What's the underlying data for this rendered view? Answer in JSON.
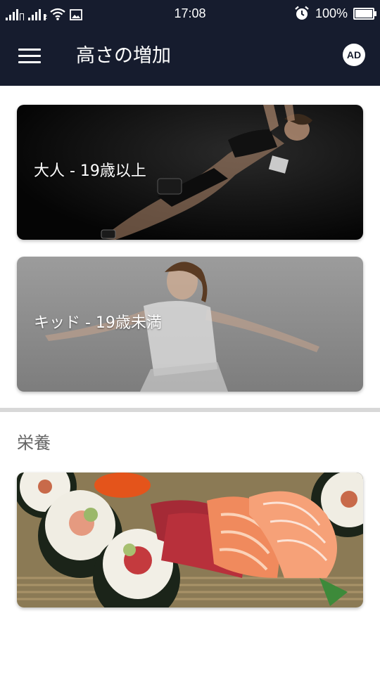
{
  "status_bar": {
    "sim1": "",
    "sim2": "2",
    "time": "17:08",
    "battery": "100%",
    "battery_level": 1.0,
    "icons": [
      "signal-icon",
      "signal-icon",
      "wifi-icon",
      "image-icon",
      "alarm-icon",
      "battery-icon"
    ]
  },
  "app_bar": {
    "title": "高さの増加",
    "avatar_initials": "AD",
    "menu_icon": "hamburger-menu-icon",
    "background": "#161c2e"
  },
  "cards": [
    {
      "label": "大人 - 19歳以上"
    },
    {
      "label": "キッド - 19歳未満"
    }
  ],
  "nutrition": {
    "section_title": "栄養"
  }
}
